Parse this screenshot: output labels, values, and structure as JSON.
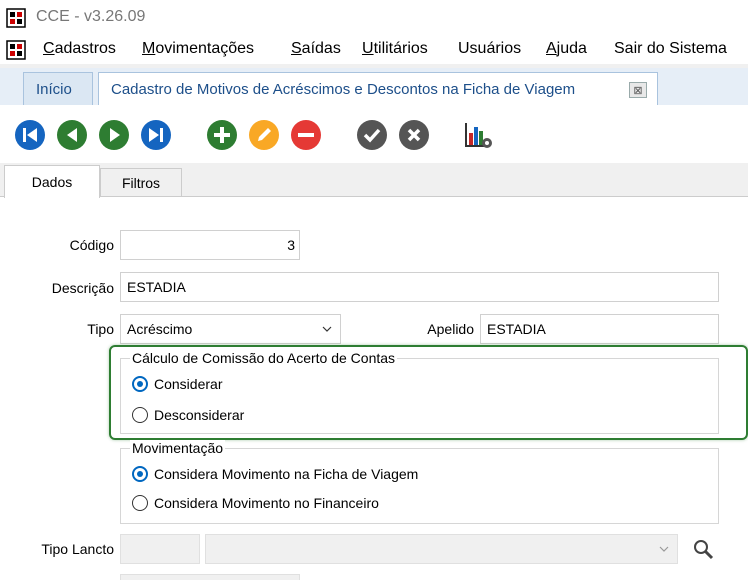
{
  "window": {
    "title": "CCE - v3.26.09",
    "app_icon": "app-icon"
  },
  "menu": {
    "items": [
      {
        "label": "Cadastros",
        "accel": "C"
      },
      {
        "label": "Movimentações",
        "accel": "M"
      },
      {
        "label": "Saídas",
        "accel": "S"
      },
      {
        "label": "Utilitários",
        "accel": "U"
      },
      {
        "label": "Usuários",
        "accel": ""
      },
      {
        "label": "Ajuda",
        "accel": "A"
      },
      {
        "label": "Sair do Sistema",
        "accel": ""
      }
    ]
  },
  "tabs": [
    {
      "label": "Início"
    },
    {
      "label": "Cadastro de Motivos de Acréscimos e Descontos na Ficha de Viagem"
    }
  ],
  "toolbar": {
    "buttons": [
      "first-record-icon",
      "previous-record-icon",
      "next-record-icon",
      "last-record-icon",
      "add-icon",
      "edit-icon",
      "delete-icon",
      "confirm-icon",
      "cancel-icon",
      "report-chart-icon"
    ],
    "colors": {
      "nav": "#1565c0",
      "nav_green": "#2e7d32",
      "add": "#2e7d32",
      "edit": "#f9a825",
      "delete": "#e53935",
      "neutral": "#555555"
    }
  },
  "subtabs": [
    {
      "label": "Dados",
      "active": true
    },
    {
      "label": "Filtros",
      "active": false
    }
  ],
  "form": {
    "codigo": {
      "label": "Código",
      "value": "3"
    },
    "descricao": {
      "label": "Descrição",
      "value": "ESTADIA"
    },
    "tipo": {
      "label": "Tipo",
      "value": "Acréscimo"
    },
    "apelido": {
      "label": "Apelido",
      "value": "ESTADIA"
    },
    "comissao": {
      "title": "Cálculo de Comissão do Acerto de Contas",
      "options": [
        {
          "label": "Considerar",
          "checked": true
        },
        {
          "label": "Desconsiderar",
          "checked": false
        }
      ]
    },
    "movimentacao": {
      "title": "Movimentação",
      "options": [
        {
          "label": "Considera Movimento na Ficha de Viagem",
          "checked": true
        },
        {
          "label": "Considera Movimento no Financeiro",
          "checked": false
        }
      ]
    },
    "tipo_lancto": {
      "label": "Tipo Lancto",
      "value": ""
    }
  },
  "highlight_color": "#2e7d32"
}
